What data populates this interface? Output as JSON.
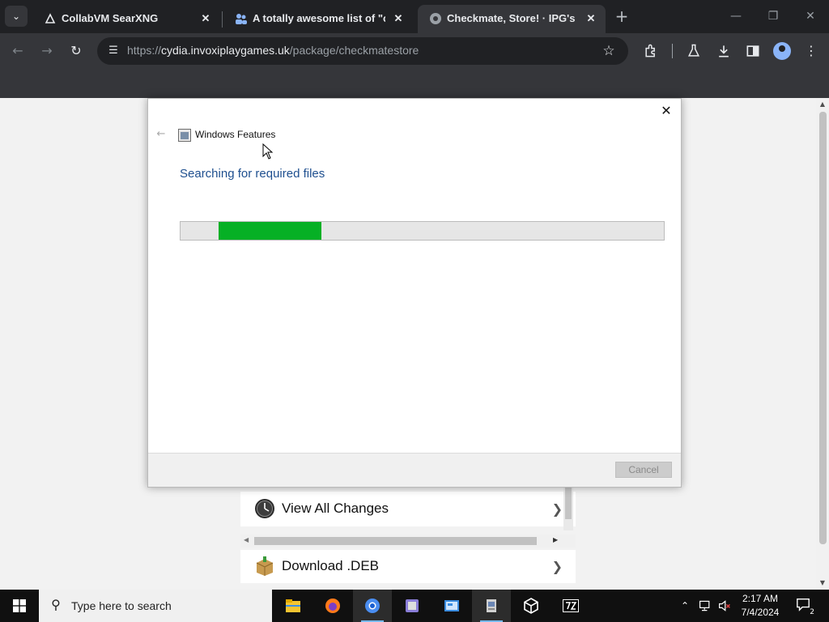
{
  "browser": {
    "tabs": [
      {
        "title": "CollabVM SearXNG",
        "active": false
      },
      {
        "title": "A totally awesome list of \"old\" v",
        "active": false
      },
      {
        "title": "Checkmate, Store! · IPG's Cydia",
        "active": true
      }
    ],
    "url_scheme": "https://",
    "url_host": "cydia.invoxiplaygames.uk",
    "url_path": "/package/checkmatestore"
  },
  "page": {
    "cells": [
      {
        "label": "View All Changes",
        "icon": "clock-icon"
      },
      {
        "label": "Download .DEB",
        "icon": "package-icon"
      }
    ]
  },
  "dialog": {
    "title": "Windows Features",
    "heading": "Searching for required files",
    "progress_start": 0.078,
    "progress_end": 0.29,
    "cancel_label": "Cancel",
    "progress_color": "#06b025"
  },
  "taskbar": {
    "search_placeholder": "Type here to search",
    "time": "2:17 AM",
    "date": "7/4/2024",
    "notification_count": "2",
    "apps": [
      "file-explorer-icon",
      "firefox-icon",
      "chromium-icon",
      "notepad-icon",
      "control-panel-icon",
      "windows-features-icon",
      "virtualbox-icon",
      "7zip-icon"
    ]
  }
}
